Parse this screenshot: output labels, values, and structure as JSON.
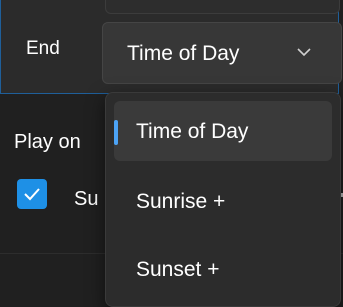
{
  "end_setting": {
    "label": "End",
    "selected_value": "Time of Day",
    "options": [
      "Time of Day",
      "Sunrise +",
      "Sunset +"
    ]
  },
  "play_on": {
    "label": "Play on",
    "checkbox_label": "Su",
    "checked": true
  },
  "colors": {
    "accent": "#1e90e6",
    "selection_indicator": "#4ca3f5",
    "background": "#202020"
  }
}
